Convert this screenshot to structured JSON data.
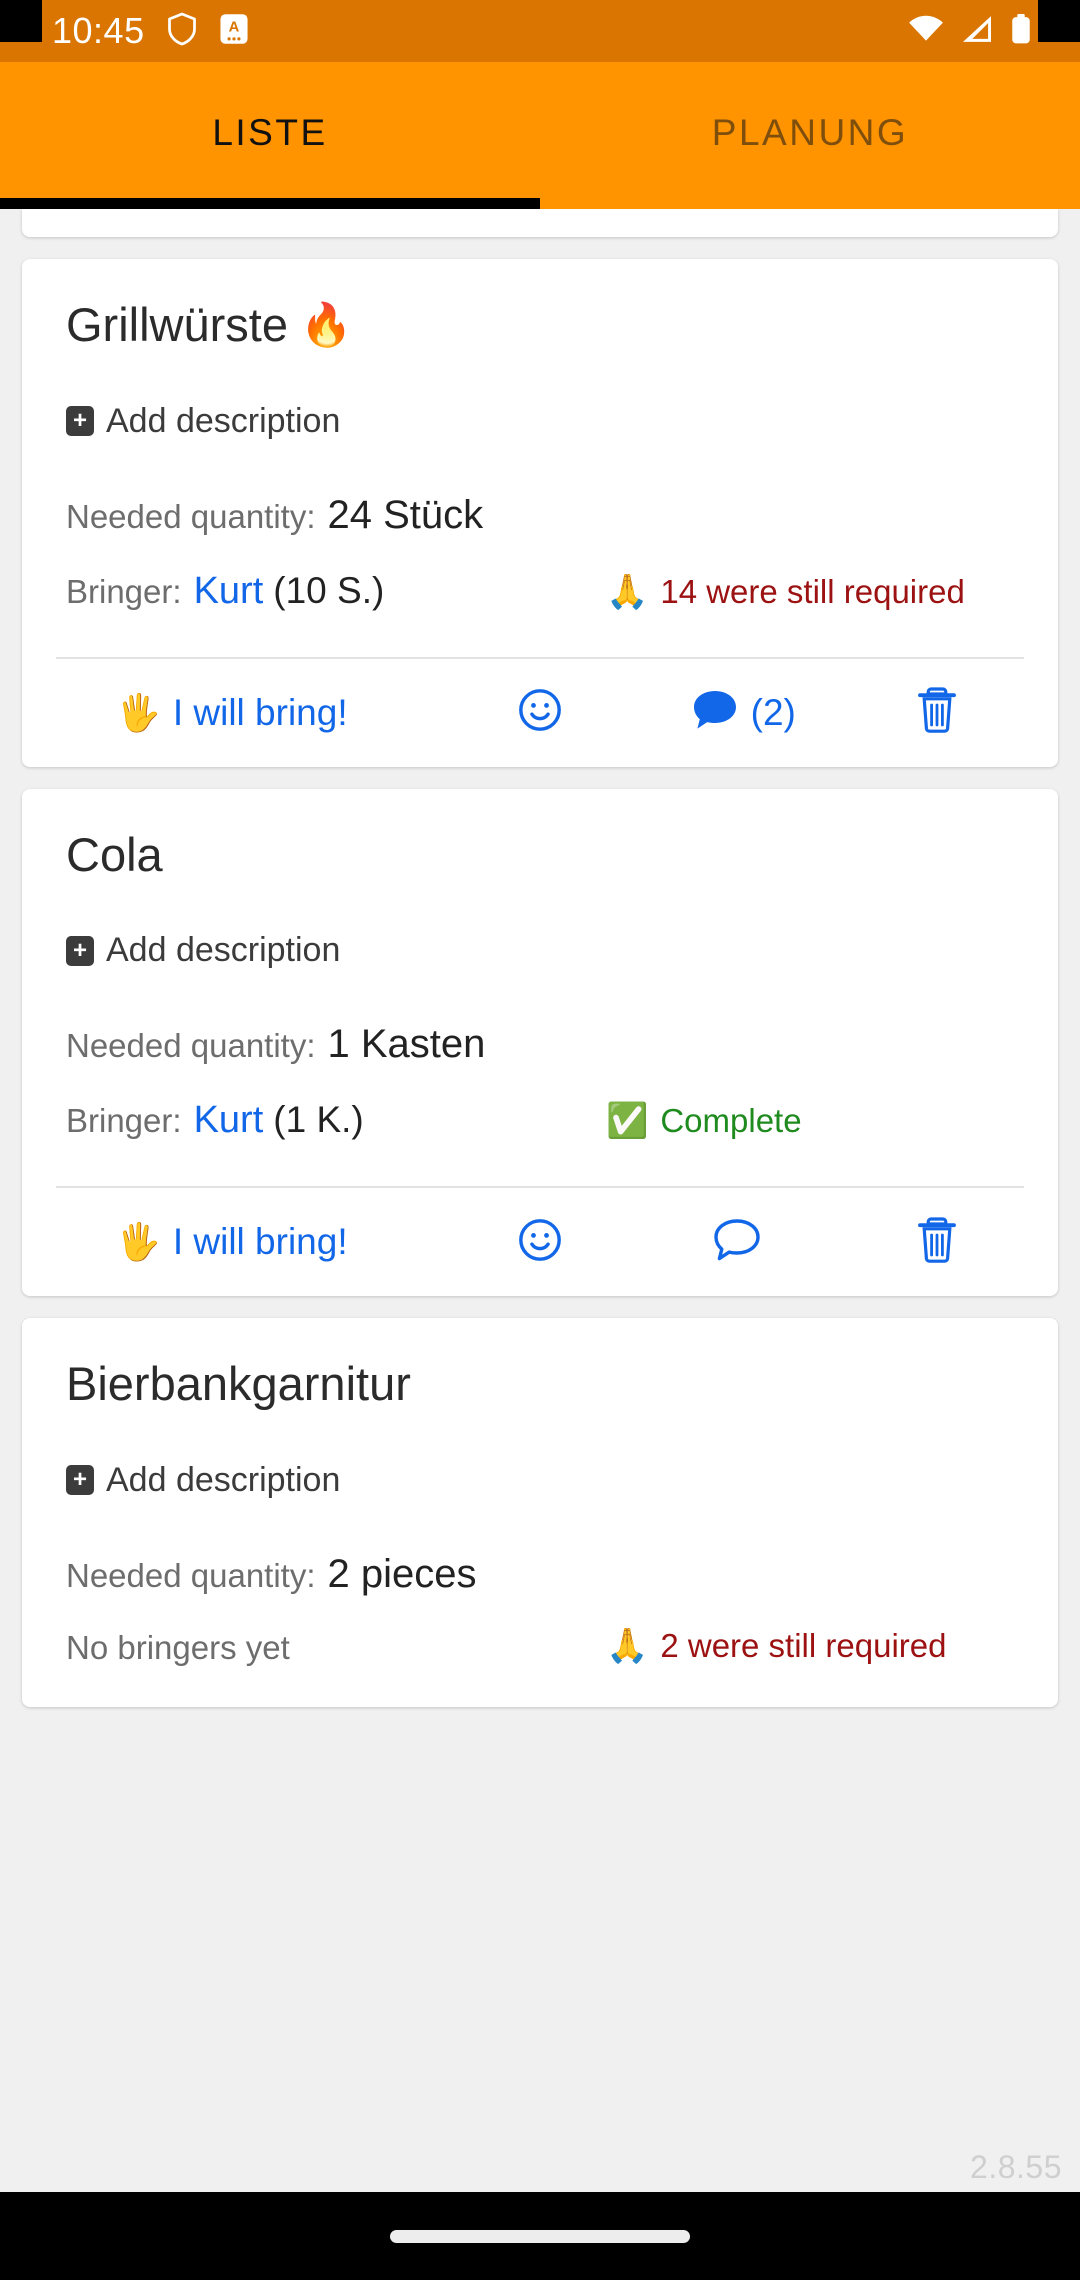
{
  "statusbar": {
    "time": "10:45",
    "icons": [
      "shield-icon",
      "notification-app-icon",
      "wifi-icon",
      "cellular-signal-icon",
      "battery-icon"
    ]
  },
  "tabs": [
    {
      "label": "LISTE",
      "active": true
    },
    {
      "label": "PLANUNG",
      "active": false
    }
  ],
  "labels": {
    "add_description": "Add description",
    "needed_quantity": "Needed quantity:",
    "bringer": "Bringer:",
    "no_bringers": "No bringers yet",
    "i_will_bring": "I will bring!"
  },
  "items": [
    {
      "title": "Grillwürste",
      "title_emoji": "🔥",
      "quantity": "24 Stück",
      "bringer_name": "Kurt",
      "bringer_amount": "(10 S.)",
      "status_text": "14 were still required",
      "status_kind": "required",
      "status_emoji": "🙏",
      "comment_count": "(2)",
      "has_comments": true
    },
    {
      "title": "Cola",
      "title_emoji": "",
      "quantity": "1 Kasten",
      "bringer_name": "Kurt",
      "bringer_amount": "(1 K.)",
      "status_text": "Complete",
      "status_kind": "complete",
      "status_emoji": "✅",
      "comment_count": "",
      "has_comments": false
    },
    {
      "title": "Bierbankgarnitur",
      "title_emoji": "",
      "quantity": "2 pieces",
      "bringer_name": "",
      "bringer_amount": "",
      "status_text": "2 were still required",
      "status_kind": "required",
      "status_emoji": "🙏",
      "comment_count": "",
      "has_comments": false
    }
  ],
  "footer": {
    "version": "2.8.55"
  },
  "colors": {
    "statusbar_bg": "#d97500",
    "tabbar_bg": "#ff9300",
    "tab_indicator": "#000000",
    "link_blue": "#1267e8",
    "required_red": "#9c1212",
    "complete_green": "#1f8b1f",
    "page_bg": "#f0f0f0"
  }
}
